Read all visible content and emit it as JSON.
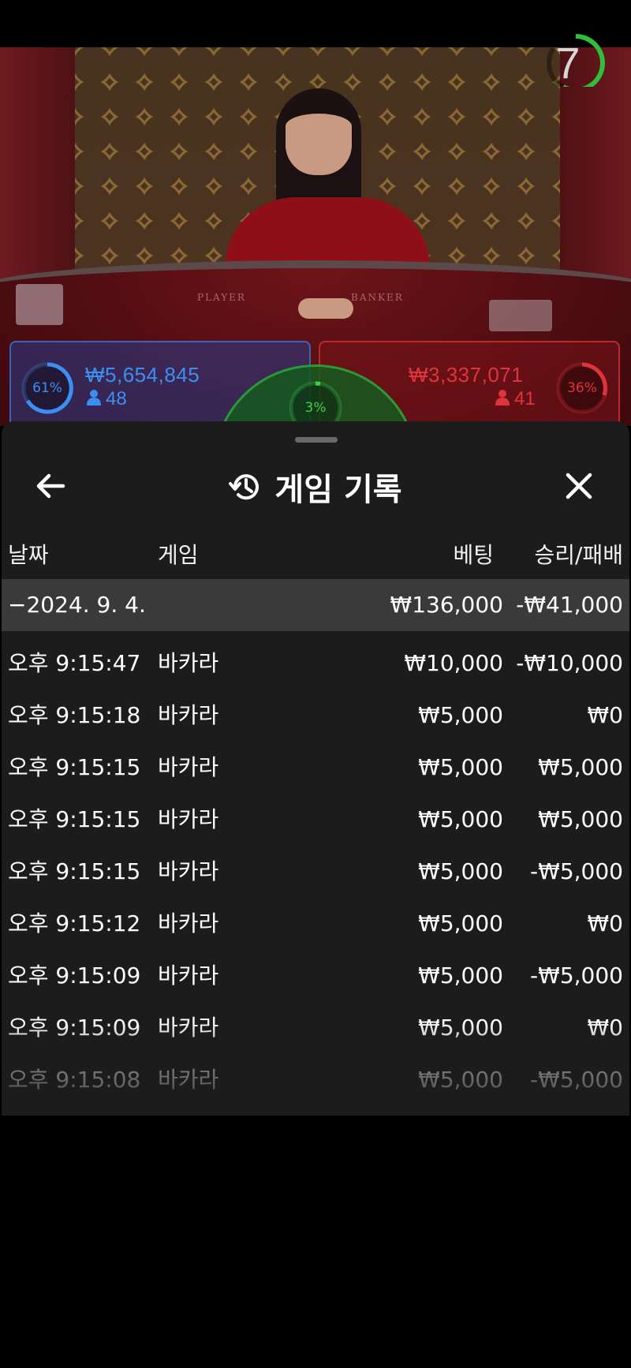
{
  "table": {
    "timer": "7",
    "felt_left_label": "PLAYER",
    "felt_right_label": "BANKER",
    "player": {
      "percent": "61%",
      "amount": "₩5,654,845",
      "players": "48",
      "color": "#3c8ff0"
    },
    "tie": {
      "percent": "3%",
      "color": "#3fd050"
    },
    "banker": {
      "percent": "36%",
      "amount": "₩3,337,071",
      "players": "41",
      "color": "#e0333b"
    }
  },
  "history": {
    "title": "게임 기록",
    "back_icon": "arrow-left-icon",
    "title_icon": "history-icon",
    "close_icon": "close-icon",
    "columns": {
      "date": "날짜",
      "game": "게임",
      "bet": "베팅",
      "result": "승리/패배"
    },
    "date_group": {
      "date": "−2024. 9. 4.",
      "bet_total": "₩136,000",
      "result_total": "-₩41,000"
    },
    "rows": [
      {
        "time": "오후 9:15:47",
        "game": "바카라",
        "bet": "₩10,000",
        "result": "-₩10,000"
      },
      {
        "time": "오후 9:15:18",
        "game": "바카라",
        "bet": "₩5,000",
        "result": "₩0"
      },
      {
        "time": "오후 9:15:15",
        "game": "바카라",
        "bet": "₩5,000",
        "result": "₩5,000"
      },
      {
        "time": "오후 9:15:15",
        "game": "바카라",
        "bet": "₩5,000",
        "result": "₩5,000"
      },
      {
        "time": "오후 9:15:15",
        "game": "바카라",
        "bet": "₩5,000",
        "result": "-₩5,000"
      },
      {
        "time": "오후 9:15:12",
        "game": "바카라",
        "bet": "₩5,000",
        "result": "₩0"
      },
      {
        "time": "오후 9:15:09",
        "game": "바카라",
        "bet": "₩5,000",
        "result": "-₩5,000"
      },
      {
        "time": "오후 9:15:09",
        "game": "바카라",
        "bet": "₩5,000",
        "result": "₩0"
      },
      {
        "time": "오후 9:15:08",
        "game": "바카라",
        "bet": "₩5,000",
        "result": "-₩5,000"
      }
    ]
  }
}
